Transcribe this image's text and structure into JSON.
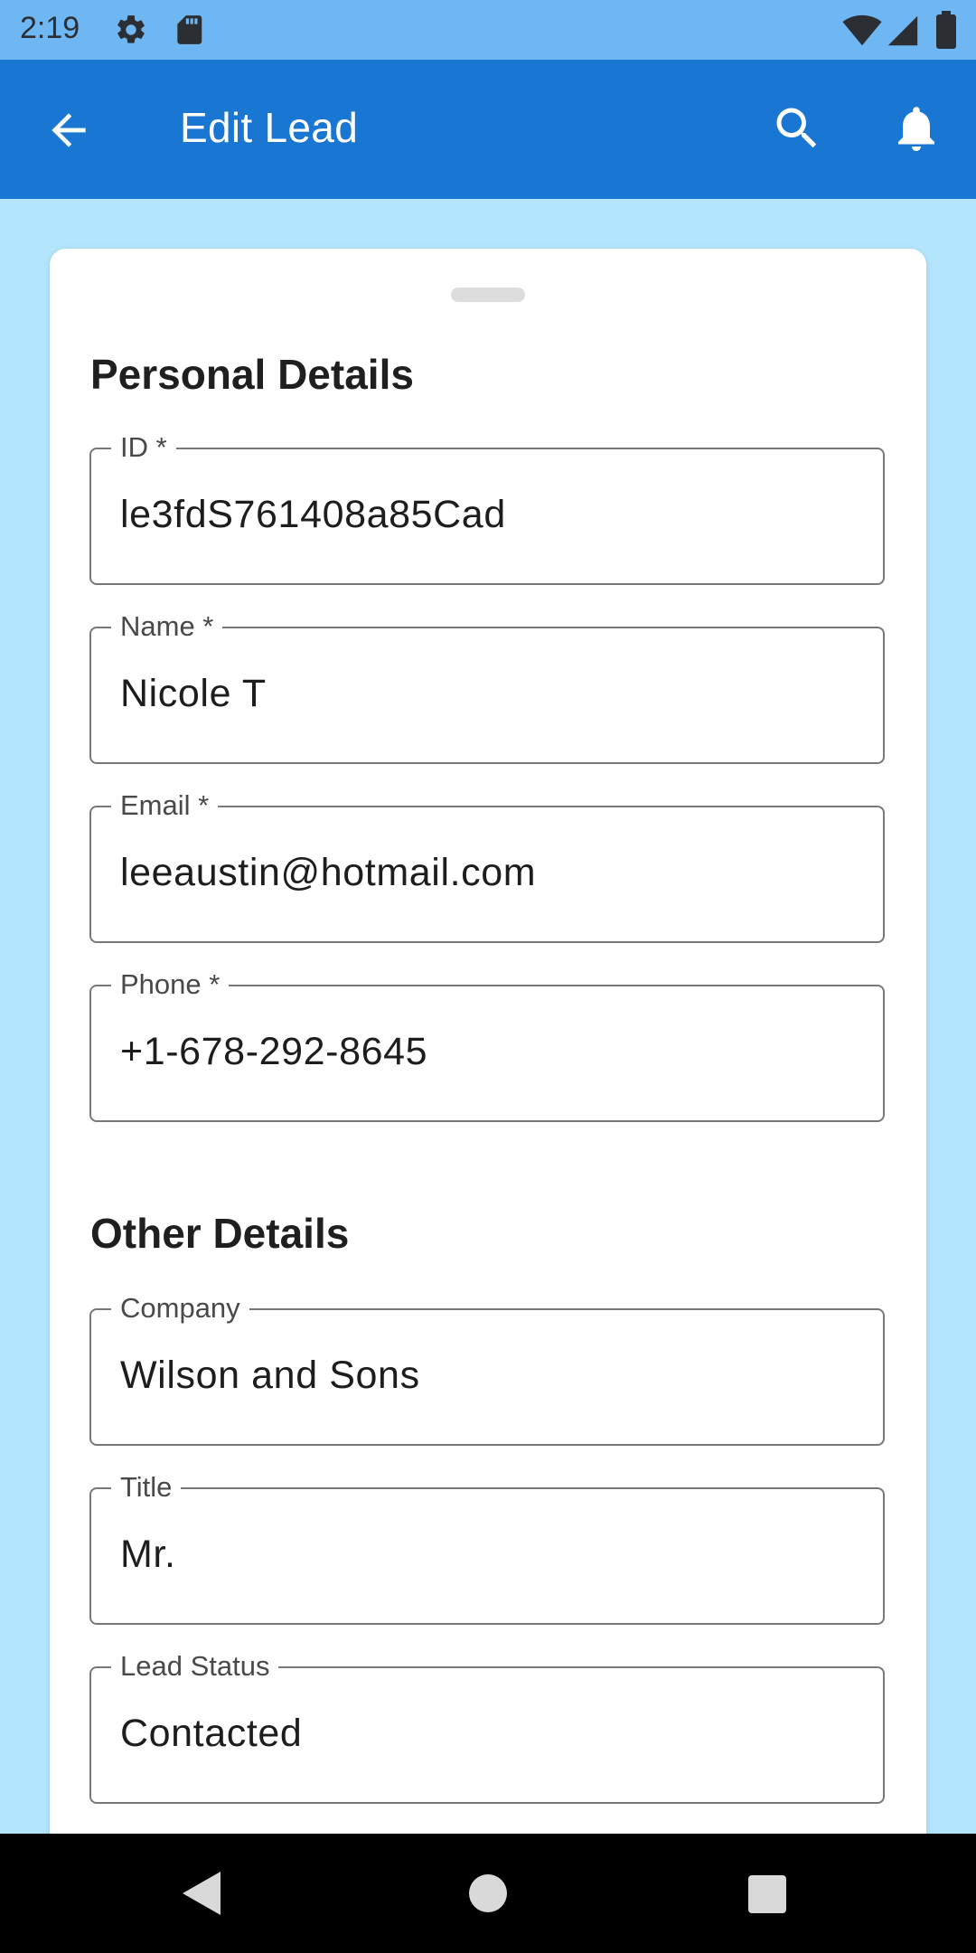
{
  "status_bar": {
    "time": "2:19",
    "icons": [
      "gear-icon",
      "sd-card-icon",
      "wifi-icon",
      "cell-signal-icon",
      "battery-icon"
    ]
  },
  "app_bar": {
    "title": "Edit Lead",
    "icons": [
      "back-arrow-icon",
      "search-icon",
      "bell-icon"
    ],
    "color": "#1976d2"
  },
  "sections": {
    "personal": {
      "title": "Personal Details",
      "fields": [
        {
          "label": "ID *",
          "value": "le3fdS761408a85Cad"
        },
        {
          "label": "Name *",
          "value": "Nicole T"
        },
        {
          "label": "Email *",
          "value": "leeaustin@hotmail.com"
        },
        {
          "label": "Phone *",
          "value": "+1-678-292-8645"
        }
      ]
    },
    "other": {
      "title": "Other Details",
      "fields": [
        {
          "label": "Company",
          "value": "Wilson and Sons"
        },
        {
          "label": "Title",
          "value": "Mr."
        },
        {
          "label": "Lead Status",
          "value": "Contacted"
        }
      ]
    }
  },
  "nav_bar": {
    "icons": [
      "nav-back-icon",
      "nav-home-icon",
      "nav-recents-icon"
    ]
  },
  "colors": {
    "background": "#b3e5fc",
    "status_bar": "#6fb7f3",
    "accent": "#1976d2"
  }
}
